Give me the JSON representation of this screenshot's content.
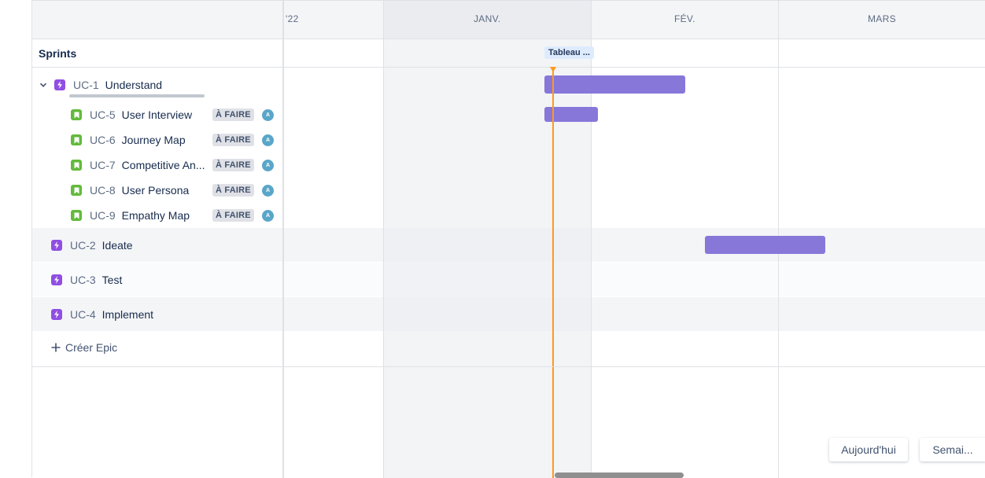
{
  "timeline": {
    "months": [
      "'22",
      "JANV.",
      "FÉV.",
      "MARS"
    ]
  },
  "sprints": {
    "label": "Sprints",
    "chip": "Tableau ..."
  },
  "epics": [
    {
      "key": "UC-1",
      "title": "Understand",
      "children": [
        {
          "key": "UC-5",
          "title": "User Interview",
          "status": "À FAIRE",
          "assignee": "A"
        },
        {
          "key": "UC-6",
          "title": "Journey Map",
          "status": "À FAIRE",
          "assignee": "A"
        },
        {
          "key": "UC-7",
          "title": "Competitive An...",
          "status": "À FAIRE",
          "assignee": "A"
        },
        {
          "key": "UC-8",
          "title": "User Persona",
          "status": "À FAIRE",
          "assignee": "A"
        },
        {
          "key": "UC-9",
          "title": "Empathy Map",
          "status": "À FAIRE",
          "assignee": "A"
        }
      ]
    },
    {
      "key": "UC-2",
      "title": "Ideate"
    },
    {
      "key": "UC-3",
      "title": "Test"
    },
    {
      "key": "UC-4",
      "title": "Implement"
    }
  ],
  "create_epic": "Créer Epic",
  "buttons": {
    "today": "Aujourd'hui",
    "week": "Semai..."
  },
  "colors": {
    "epic_bar": "#8777d9",
    "today_line": "#ff991f",
    "epic_icon": "#904ee2",
    "story_icon": "#63ba3c"
  }
}
